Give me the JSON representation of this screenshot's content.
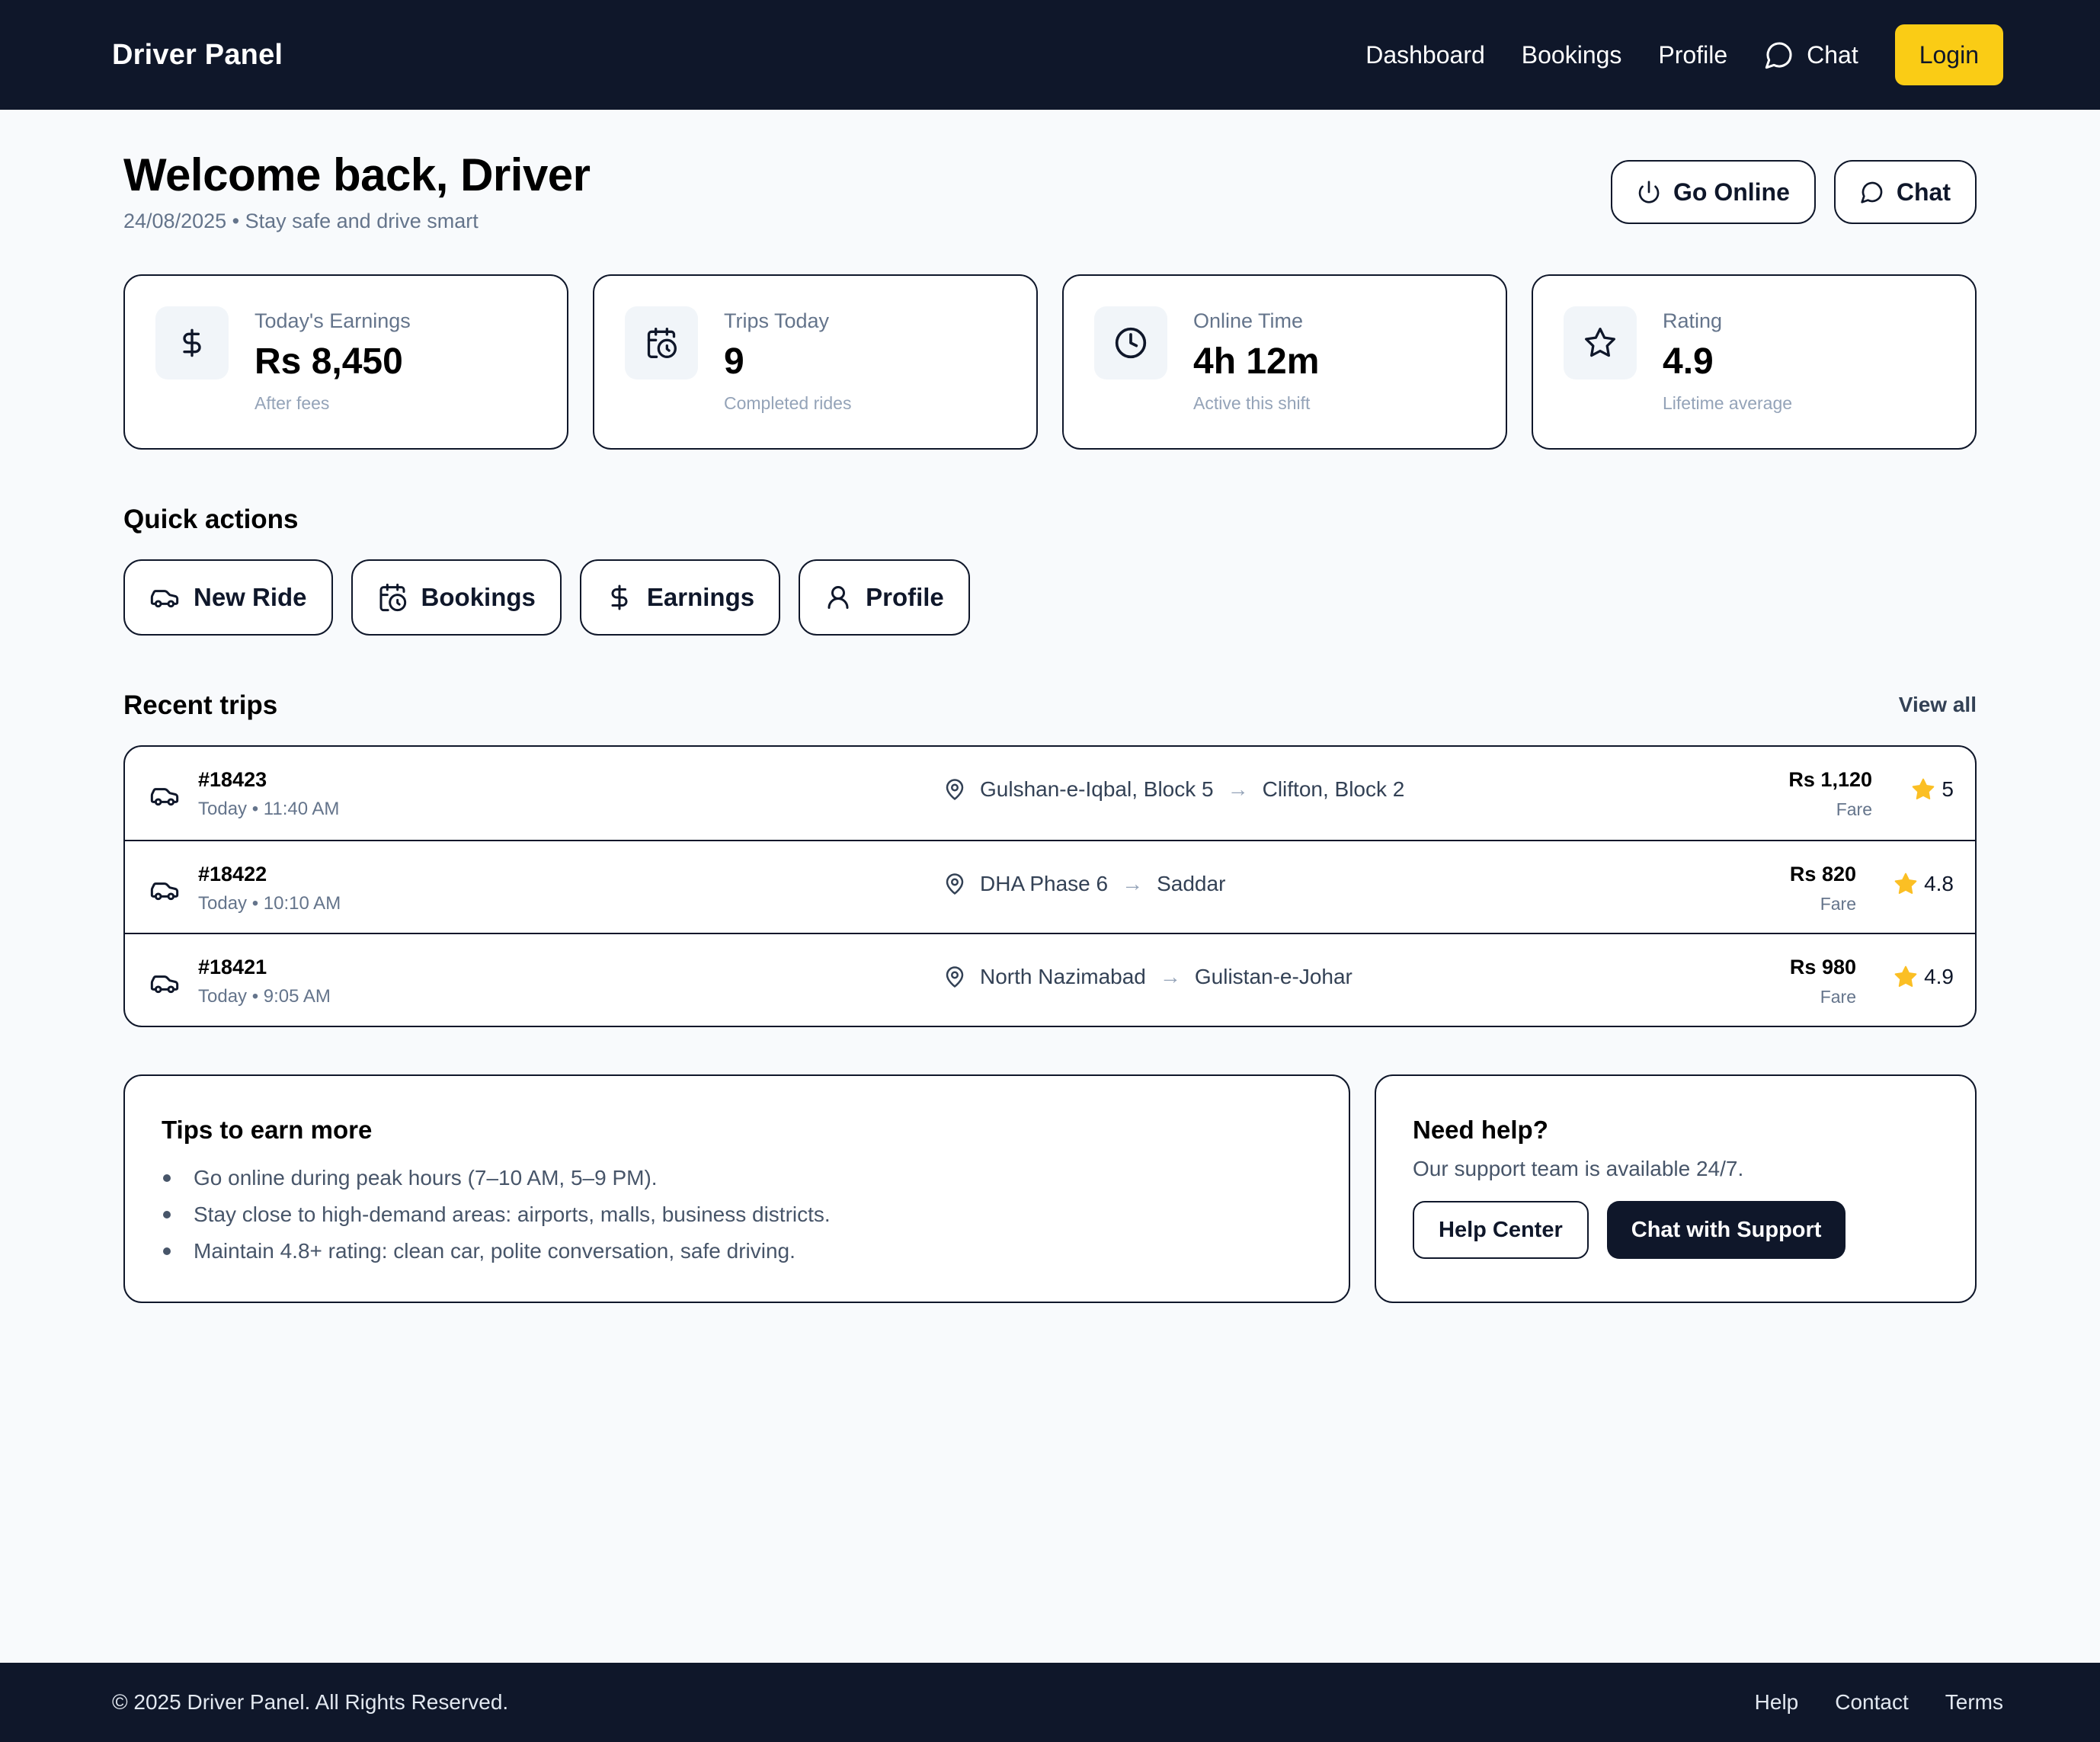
{
  "header": {
    "brand": "Driver Panel",
    "nav": {
      "dashboard": "Dashboard",
      "bookings": "Bookings",
      "profile": "Profile",
      "chat": "Chat",
      "login": "Login"
    }
  },
  "welcome": {
    "title": "Welcome back, Driver",
    "subtitle": "24/08/2025 • Stay safe and drive smart",
    "go_online": "Go Online",
    "chat": "Chat"
  },
  "stats": [
    {
      "icon": "dollar-icon",
      "label": "Today's Earnings",
      "value": "Rs 8,450",
      "note": "After fees"
    },
    {
      "icon": "calendar-clock-icon",
      "label": "Trips Today",
      "value": "9",
      "note": "Completed rides"
    },
    {
      "icon": "clock-icon",
      "label": "Online Time",
      "value": "4h 12m",
      "note": "Active this shift"
    },
    {
      "icon": "star-icon",
      "label": "Rating",
      "value": "4.9",
      "note": "Lifetime average"
    }
  ],
  "quick_actions": {
    "title": "Quick actions",
    "items": [
      {
        "icon": "car-icon",
        "label": "New Ride"
      },
      {
        "icon": "calendar-clock-icon",
        "label": "Bookings"
      },
      {
        "icon": "dollar-icon",
        "label": "Earnings"
      },
      {
        "icon": "user-icon",
        "label": "Profile"
      }
    ]
  },
  "recent_trips": {
    "title": "Recent trips",
    "view_all": "View all",
    "rows": [
      {
        "id": "#18423",
        "time": "Today • 11:40 AM",
        "from": "Gulshan-e-Iqbal, Block 5",
        "to": "Clifton, Block 2",
        "fare": "Rs 1,120",
        "fare_label": "Fare",
        "rating": "5"
      },
      {
        "id": "#18422",
        "time": "Today • 10:10 AM",
        "from": "DHA Phase 6",
        "to": "Saddar",
        "fare": "Rs 820",
        "fare_label": "Fare",
        "rating": "4.8"
      },
      {
        "id": "#18421",
        "time": "Today • 9:05 AM",
        "from": "North Nazimabad",
        "to": "Gulistan-e-Johar",
        "fare": "Rs 980",
        "fare_label": "Fare",
        "rating": "4.9"
      }
    ],
    "arrow": "→"
  },
  "tips": {
    "title": "Tips to earn more",
    "items": [
      "Go online during peak hours (7–10 AM, 5–9 PM).",
      "Stay close to high-demand areas: airports, malls, business districts.",
      "Maintain 4.8+ rating: clean car, polite conversation, safe driving."
    ]
  },
  "help": {
    "title": "Need help?",
    "subtitle": "Our support team is available 24/7.",
    "help_center": "Help Center",
    "chat_support": "Chat with Support"
  },
  "footer": {
    "copyright": "© 2025 Driver Panel. All Rights Reserved.",
    "links": [
      "Help",
      "Contact",
      "Terms"
    ]
  },
  "colors": {
    "navy": "#0f172a",
    "accent_yellow": "#facc15",
    "star": "#fbbf24",
    "background": "#f8fafc"
  }
}
